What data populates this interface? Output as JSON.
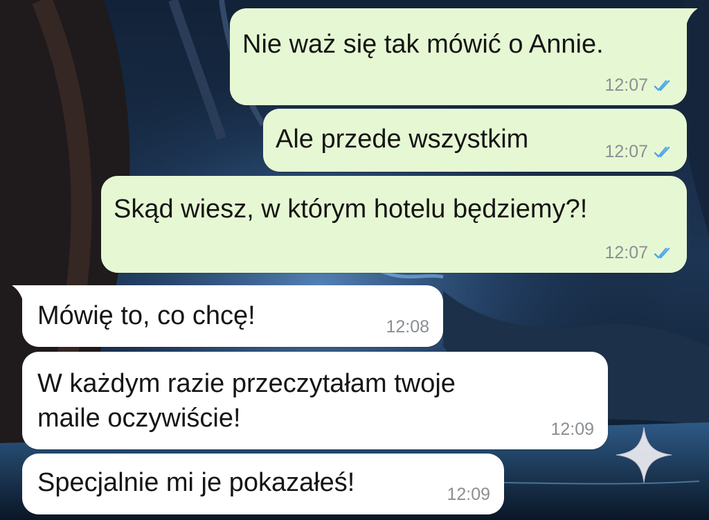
{
  "colors": {
    "outgoing_bubble": "#e6f8d3",
    "incoming_bubble": "#ffffff",
    "timestamp": "#8a8f93",
    "read_ticks": "#4fa6e8"
  },
  "messages": [
    {
      "direction": "outgoing",
      "text": "Nie waż się tak mówić o Annie.",
      "time": "12:07",
      "status": "read"
    },
    {
      "direction": "outgoing",
      "text": "Ale przede wszystkim",
      "time": "12:07",
      "status": "read"
    },
    {
      "direction": "outgoing",
      "text": "Skąd wiesz, w którym hotelu będziemy?!",
      "time": "12:07",
      "status": "read"
    },
    {
      "direction": "incoming",
      "text": "Mówię to, co chcę!",
      "time": "12:08"
    },
    {
      "direction": "incoming",
      "text_lines": [
        "W każdym razie przeczytałam twoje",
        "maile oczywiście!"
      ],
      "time": "12:09"
    },
    {
      "direction": "incoming",
      "text": "Specjalnie mi je pokazałeś!",
      "time": "12:09"
    }
  ],
  "icons": {
    "read_receipt": "double-check-icon",
    "overlay": "sparkle-icon"
  }
}
